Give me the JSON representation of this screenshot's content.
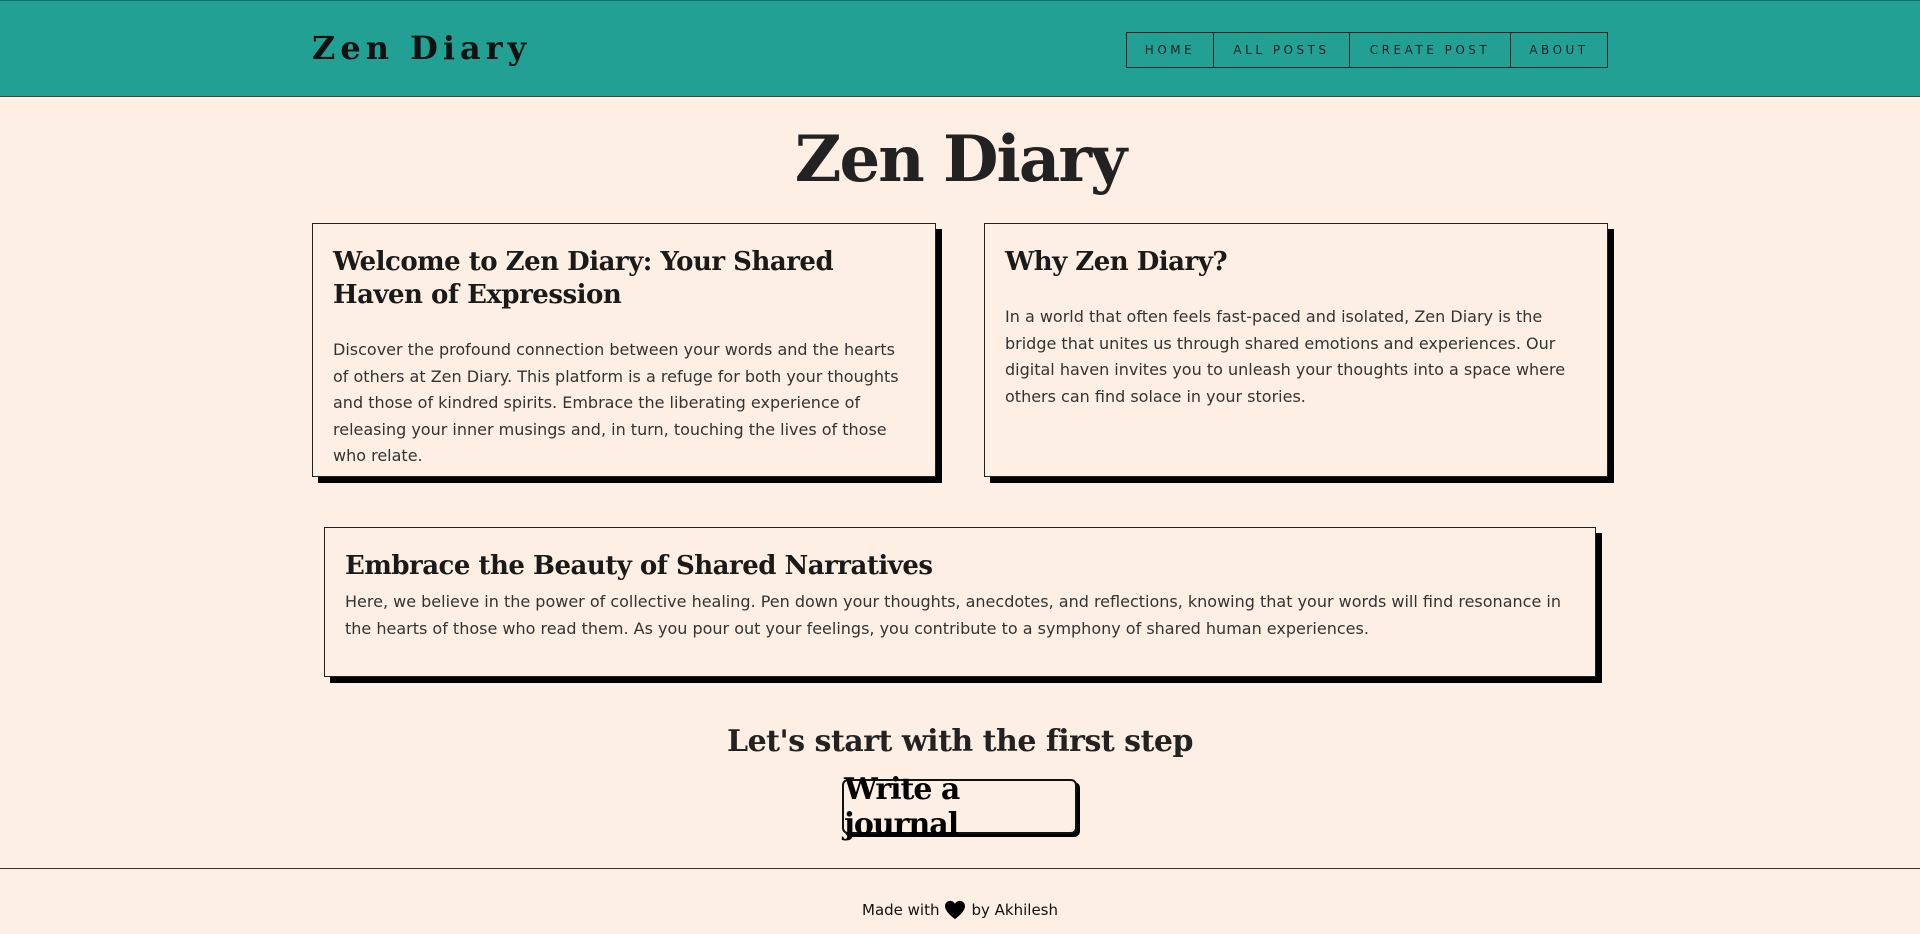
{
  "header": {
    "brand": "Zen Diary",
    "nav": [
      "HOME",
      "ALL POSTS",
      "CREATE POST",
      "ABOUT"
    ]
  },
  "hero": {
    "title": "Zen Diary"
  },
  "cards": [
    {
      "title": "Welcome to Zen Diary: Your Shared Haven of Expression",
      "body": "Discover the profound connection between your words and the hearts of others at Zen Diary. This platform is a refuge for both your thoughts and those of kindred spirits. Embrace the liberating experience of releasing your inner musings and, in turn, touching the lives of those who relate."
    },
    {
      "title": "Why Zen Diary?",
      "body": "In a world that often feels fast-paced and isolated, Zen Diary is the bridge that unites us through shared emotions and experiences. Our digital haven invites you to unleash your thoughts into a space where others can find solace in your stories."
    },
    {
      "title": "Embrace the Beauty of Shared Narratives",
      "body": "Here, we believe in the power of collective healing. Pen down your thoughts, anecdotes, and reflections, knowing that your words will find resonance in the hearts of those who read them. As you pour out your feelings, you contribute to a symphony of shared human experiences."
    }
  ],
  "cta": {
    "heading": "Let's start with the first step",
    "button": "Write a journal"
  },
  "footer": {
    "prefix": "Made with",
    "icon": "heart-icon",
    "suffix": "by Akhilesh"
  },
  "colors": {
    "navbar": "#22a094",
    "background": "#feefe4",
    "text": "#222222"
  }
}
